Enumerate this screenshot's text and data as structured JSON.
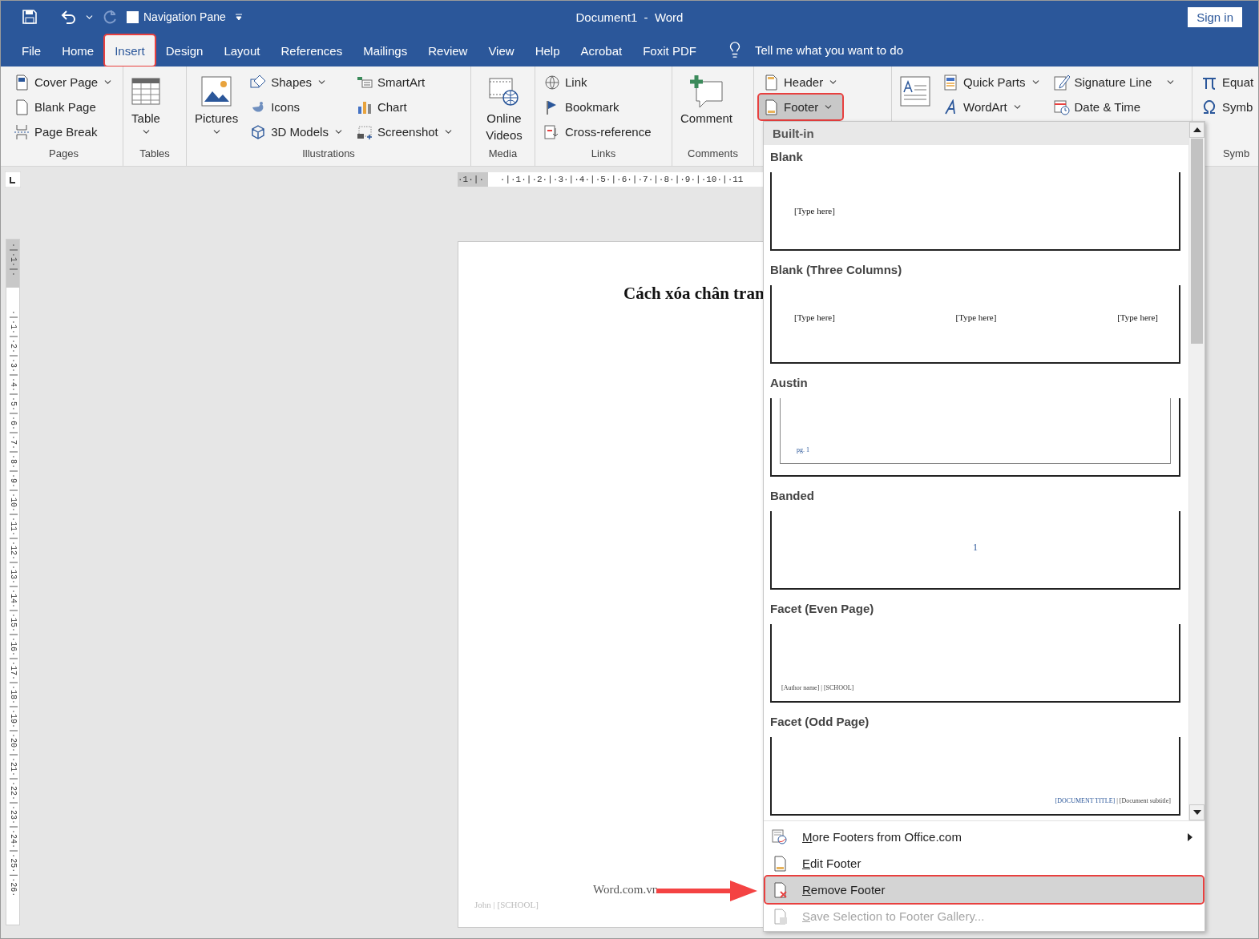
{
  "title_bar": {
    "navigation_pane": {
      "label": "Navigation Pane",
      "checked": false
    },
    "title": "Document1  -  Word",
    "sign_in": "Sign in"
  },
  "tabs": [
    {
      "label": "File",
      "selected": false,
      "highlighted": false
    },
    {
      "label": "Home",
      "selected": false,
      "highlighted": false
    },
    {
      "label": "Insert",
      "selected": true,
      "highlighted": true
    },
    {
      "label": "Design",
      "selected": false,
      "highlighted": false
    },
    {
      "label": "Layout",
      "selected": false,
      "highlighted": false
    },
    {
      "label": "References",
      "selected": false,
      "highlighted": false
    },
    {
      "label": "Mailings",
      "selected": false,
      "highlighted": false
    },
    {
      "label": "Review",
      "selected": false,
      "highlighted": false
    },
    {
      "label": "View",
      "selected": false,
      "highlighted": false
    },
    {
      "label": "Help",
      "selected": false,
      "highlighted": false
    },
    {
      "label": "Acrobat",
      "selected": false,
      "highlighted": false
    },
    {
      "label": "Foxit PDF",
      "selected": false,
      "highlighted": false
    }
  ],
  "tell_me": "Tell me what you want to do",
  "ribbon": {
    "groups": [
      {
        "label": "Pages",
        "columns": [
          [
            {
              "label": "Cover Page",
              "kind": "small",
              "caret": true
            },
            {
              "label": "Blank Page",
              "kind": "small",
              "caret": false
            },
            {
              "label": "Page Break",
              "kind": "small",
              "caret": false
            }
          ]
        ]
      },
      {
        "label": "Tables",
        "columns": [
          [
            {
              "label": "Table",
              "kind": "large",
              "caret": true
            }
          ]
        ]
      },
      {
        "label": "Illustrations",
        "columns": [
          [
            {
              "label": "Pictures",
              "kind": "large",
              "caret": true
            }
          ],
          [
            {
              "label": "Shapes",
              "kind": "small",
              "caret": true
            },
            {
              "label": "Icons",
              "kind": "small",
              "caret": false
            },
            {
              "label": "3D Models",
              "kind": "small",
              "caret": true
            }
          ],
          [
            {
              "label": "SmartArt",
              "kind": "small",
              "caret": false
            },
            {
              "label": "Chart",
              "kind": "small",
              "caret": false
            },
            {
              "label": "Screenshot",
              "kind": "small",
              "caret": true
            }
          ]
        ]
      },
      {
        "label": "Media",
        "columns": [
          [
            {
              "label": "Online Videos",
              "kind": "large",
              "caret": false
            }
          ]
        ]
      },
      {
        "label": "Links",
        "columns": [
          [
            {
              "label": "Link",
              "kind": "small",
              "caret": false
            },
            {
              "label": "Bookmark",
              "kind": "small",
              "caret": false
            },
            {
              "label": "Cross-reference",
              "kind": "small",
              "caret": false
            }
          ]
        ]
      },
      {
        "label": "Comments",
        "columns": [
          [
            {
              "label": "Comment",
              "kind": "large",
              "caret": false
            }
          ]
        ]
      },
      {
        "columns": [
          [
            {
              "label": "Header",
              "kind": "small",
              "caret": true,
              "selected": false,
              "highlighted": false
            },
            {
              "label": "Footer",
              "kind": "small",
              "caret": true,
              "selected": true,
              "highlighted": true
            }
          ]
        ]
      },
      {
        "columns": [
          [
            {
              "kind": "large",
              "caret": false
            }
          ],
          [
            {
              "label": "Quick Parts",
              "kind": "small",
              "caret": true
            },
            {
              "label": "WordArt",
              "kind": "small",
              "caret": true
            }
          ],
          [
            {
              "label": "Signature Line",
              "kind": "small",
              "caret": false
            },
            {
              "label": "Date & Time",
              "kind": "small",
              "caret": false
            }
          ],
          [
            {
              "kind": "caret"
            }
          ]
        ]
      },
      {
        "label": "Symb",
        "columns": [
          [
            {
              "label": "Equat",
              "kind": "small",
              "caret": false
            },
            {
              "label": "Symb",
              "kind": "small",
              "caret": false
            }
          ]
        ]
      }
    ]
  },
  "rulers": {
    "horizontal": "·1·|·   ·|·1·|·2·|·3·|·4·|·5·|·6·|·7·|·8·|·9·|·10·|·11",
    "vertical": "·|·1·|·       ·|·1·|·2·|·3·|·4·|·5·|·6·|·7·|·8·|·9·|·10·|·11·|·12·|·13·|·14·|·15·|·16·|·17·|·18·|·19·|·20·|·21·|·22·|·23·|·24·|·25·|·26·"
  },
  "document": {
    "title": "Cách xóa chân tran",
    "footer_center": "Word.com.vn",
    "footer_left": "John | [SCHOOL]"
  },
  "footer_menu": {
    "section": "Built-in",
    "gallery": [
      {
        "name": "Blank",
        "kind": "blank",
        "texts": [
          "[Type here]"
        ]
      },
      {
        "name": "Blank (Three Columns)",
        "kind": "three_columns",
        "texts": [
          "[Type here]",
          "[Type here]",
          "[Type here]"
        ]
      },
      {
        "name": "Austin",
        "kind": "austin",
        "texts": [
          "pg. 1"
        ]
      },
      {
        "name": "Banded",
        "kind": "banded",
        "texts": [
          "1"
        ]
      },
      {
        "name": "Facet (Even Page)",
        "kind": "facet_even",
        "texts": [
          "[Author name] | [SCHOOL]"
        ]
      },
      {
        "name": "Facet (Odd Page)",
        "kind": "facet_odd",
        "texts": [
          "[DOCUMENT TITLE]",
          " | [Document subtitle]"
        ]
      }
    ],
    "actions": [
      {
        "label": "More Footers from Office.com",
        "has_submenu": true,
        "disabled": false,
        "selected": false,
        "highlighted": false
      },
      {
        "label": "Edit Footer",
        "has_submenu": false,
        "disabled": false,
        "selected": false,
        "highlighted": false
      },
      {
        "label": "Remove Footer",
        "has_submenu": false,
        "disabled": false,
        "selected": true,
        "highlighted": true
      },
      {
        "label": "Save Selection to Footer Gallery...",
        "has_submenu": false,
        "disabled": true,
        "selected": false,
        "highlighted": false
      }
    ]
  }
}
